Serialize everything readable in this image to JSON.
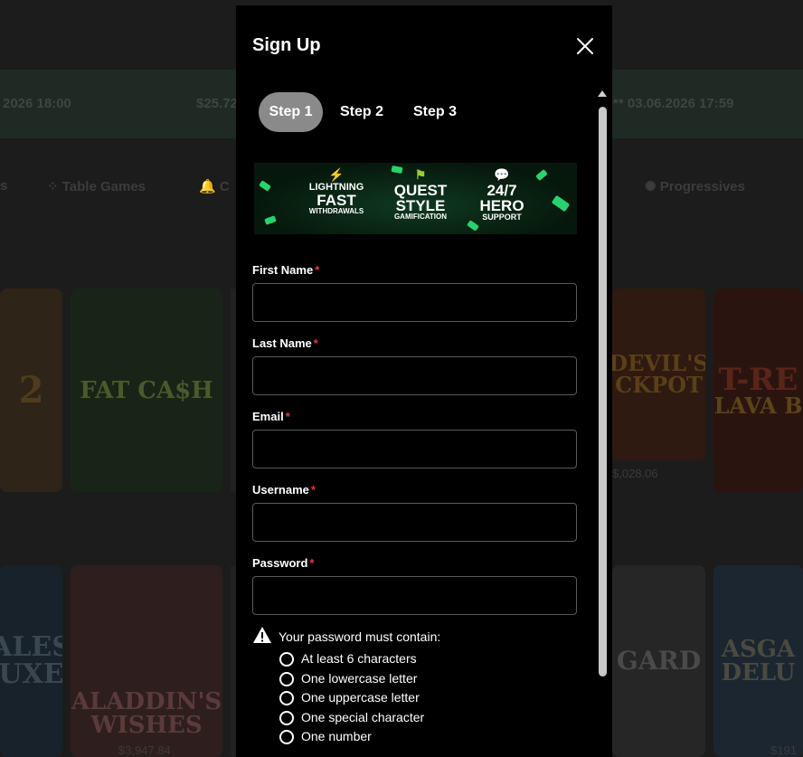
{
  "background": {
    "ticker": [
      "2026 18:00",
      "$25.72",
      "** 03.06.2026 17:59"
    ],
    "nav": [
      "s",
      "Table Games",
      "C",
      "Progressives"
    ],
    "cards_row1": [
      "FAT CA$H",
      "T-RE",
      "LAVA B",
      "DEVIL'S",
      "CKPOT"
    ],
    "cards_row2": [
      "ALES",
      "UXE",
      "ALADDIN'S",
      "WISHES",
      "GARD",
      "ASGA",
      "DELU"
    ],
    "amounts": [
      "$,028.06",
      "$3,947.84",
      "$191"
    ]
  },
  "modal": {
    "title": "Sign Up",
    "steps": [
      "Step 1",
      "Step 2",
      "Step 3"
    ],
    "active_step": 0,
    "banner": {
      "f1": {
        "l1": "LIGHTNING",
        "l2": "FAST",
        "l3": "WITHDRAWALS"
      },
      "f2": {
        "l1": "QUEST",
        "l2": "STYLE",
        "l3": "GAMIFICATION"
      },
      "f3": {
        "l1": "24/7",
        "l2": "HERO",
        "l3": "SUPPORT"
      }
    },
    "required_mark": "*",
    "fields": {
      "first_name": {
        "label": "First Name",
        "value": ""
      },
      "last_name": {
        "label": "Last Name",
        "value": ""
      },
      "email": {
        "label": "Email",
        "value": ""
      },
      "username": {
        "label": "Username",
        "value": ""
      },
      "password": {
        "label": "Password",
        "value": ""
      }
    },
    "password_rules_title": "Your password must contain:",
    "password_rules": [
      "At least 6 characters",
      "One lowercase letter",
      "One uppercase letter",
      "One special character",
      "One number"
    ]
  },
  "colors": {
    "accent_required": "#e53935",
    "active_step_bg": "#8a8a8a",
    "banner_green": "#27d36e"
  }
}
